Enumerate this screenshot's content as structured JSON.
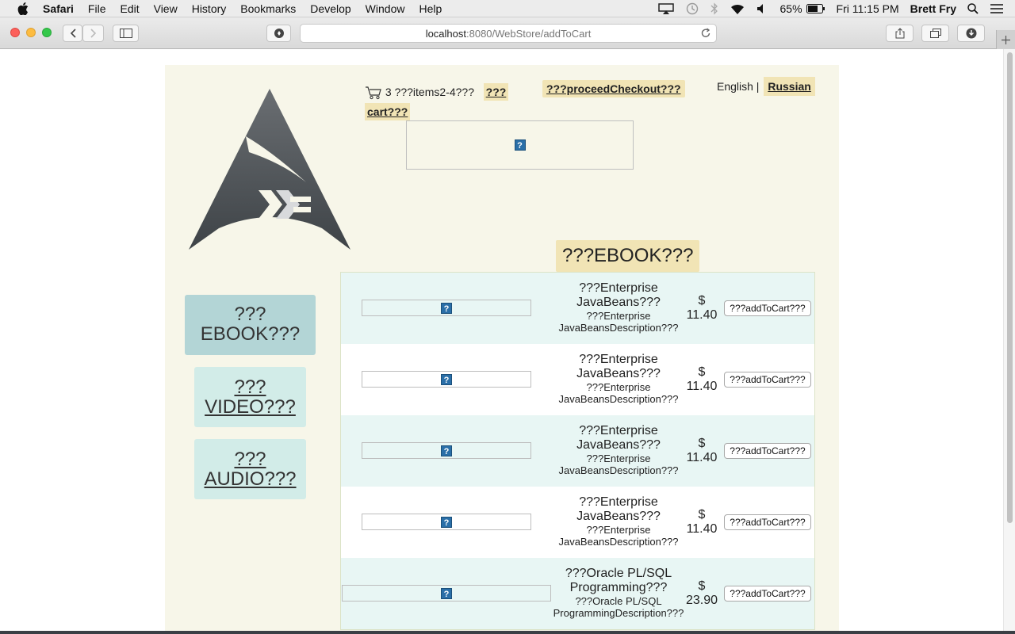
{
  "menubar": {
    "app": "Safari",
    "items": [
      "File",
      "Edit",
      "View",
      "History",
      "Bookmarks",
      "Develop",
      "Window",
      "Help"
    ],
    "battery": "65%",
    "clock": "Fri 11:15 PM",
    "user": "Brett Fry"
  },
  "browser": {
    "url_host": "localhost",
    "url_path": ":8080/WebStore/addToCart"
  },
  "header": {
    "cart_count": "3",
    "cart_items_text": "???items2-4???",
    "cart_link_part1": "???",
    "cart_link_part2": "cart???",
    "checkout_label": "???proceedCheckout???",
    "lang_english": "English |",
    "lang_russian": "Russian",
    "broken_image_glyph": "?"
  },
  "category_title": "???EBOOK???",
  "sidebar": {
    "ebook_line1": "???",
    "ebook_line2": "EBOOK???",
    "video_line1": "???",
    "video_line2": "VIDEO???",
    "audio_line1": "???",
    "audio_line2": "AUDIO???"
  },
  "products": [
    {
      "title": "???Enterprise JavaBeans???",
      "description": "???Enterprise JavaBeansDescription???",
      "currency": "$",
      "price": "11.40",
      "button": "???addToCart???",
      "img": "?"
    },
    {
      "title": "???Enterprise JavaBeans???",
      "description": "???Enterprise JavaBeansDescription???",
      "currency": "$",
      "price": "11.40",
      "button": "???addToCart???",
      "img": "?"
    },
    {
      "title": "???Enterprise JavaBeans???",
      "description": "???Enterprise JavaBeansDescription???",
      "currency": "$",
      "price": "11.40",
      "button": "???addToCart???",
      "img": "?"
    },
    {
      "title": "???Enterprise JavaBeans???",
      "description": "???Enterprise JavaBeansDescription???",
      "currency": "$",
      "price": "11.40",
      "button": "???addToCart???",
      "img": "?"
    },
    {
      "title": "???Oracle PL/SQL Programming???",
      "description": "???Oracle PL/SQL ProgrammingDescription???",
      "currency": "$",
      "price": "23.90",
      "button": "???addToCart???",
      "img": "?"
    }
  ],
  "colors": {
    "page_bg": "#f7f6e9",
    "pill_bg": "#f1e4b5",
    "sidebar_active": "#b3d5d6",
    "sidebar_idle": "#d2ece8",
    "row_alt": "#e8f6f4"
  }
}
